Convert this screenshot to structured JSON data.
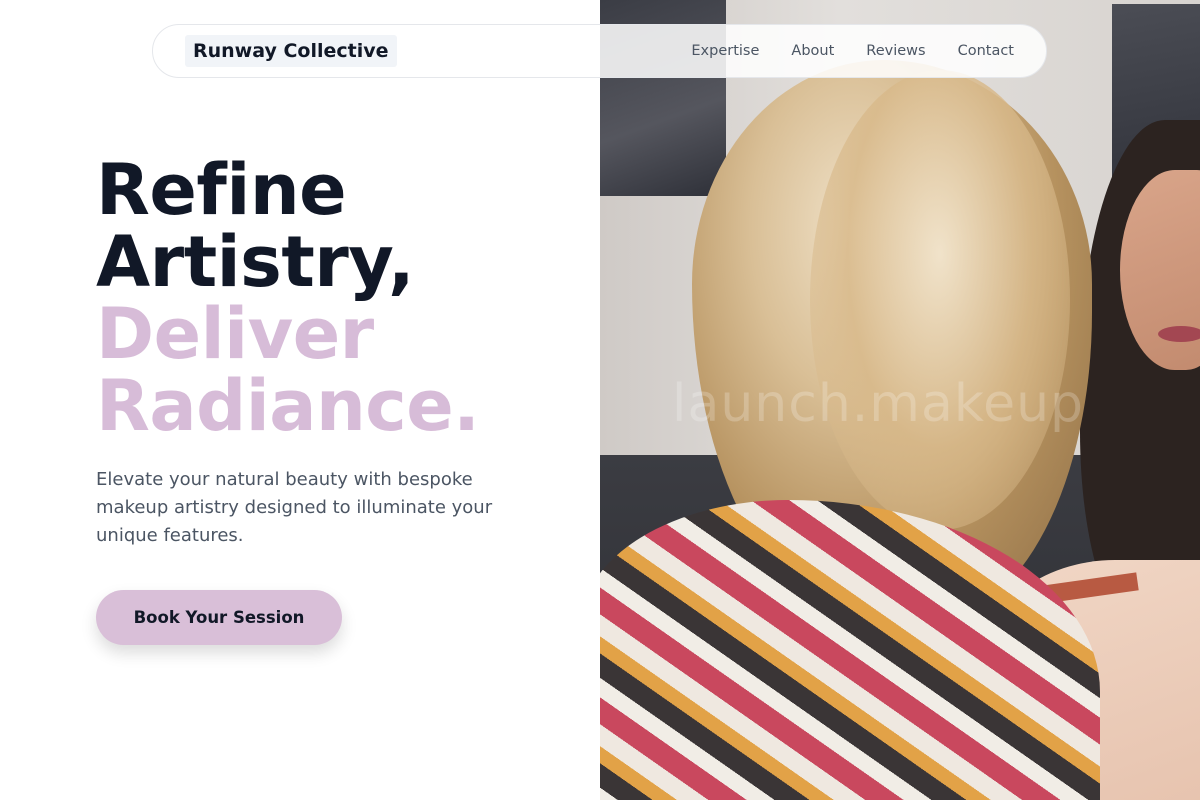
{
  "header": {
    "brand": "Runway Collective",
    "nav": [
      {
        "label": "Expertise"
      },
      {
        "label": "About"
      },
      {
        "label": "Reviews"
      },
      {
        "label": "Contact"
      }
    ]
  },
  "hero": {
    "title_lines": [
      "Refine",
      "Artistry,"
    ],
    "accent_lines": [
      "Deliver",
      "Radiance."
    ],
    "subtitle": "Elevate your natural beauty with bespoke makeup artistry designed to illuminate your unique features.",
    "cta_label": "Book Your Session",
    "accent_color": "#d7bcd8"
  },
  "image": {
    "watermark": "launch.makeup",
    "description_icon": "makeup-session-photo"
  }
}
